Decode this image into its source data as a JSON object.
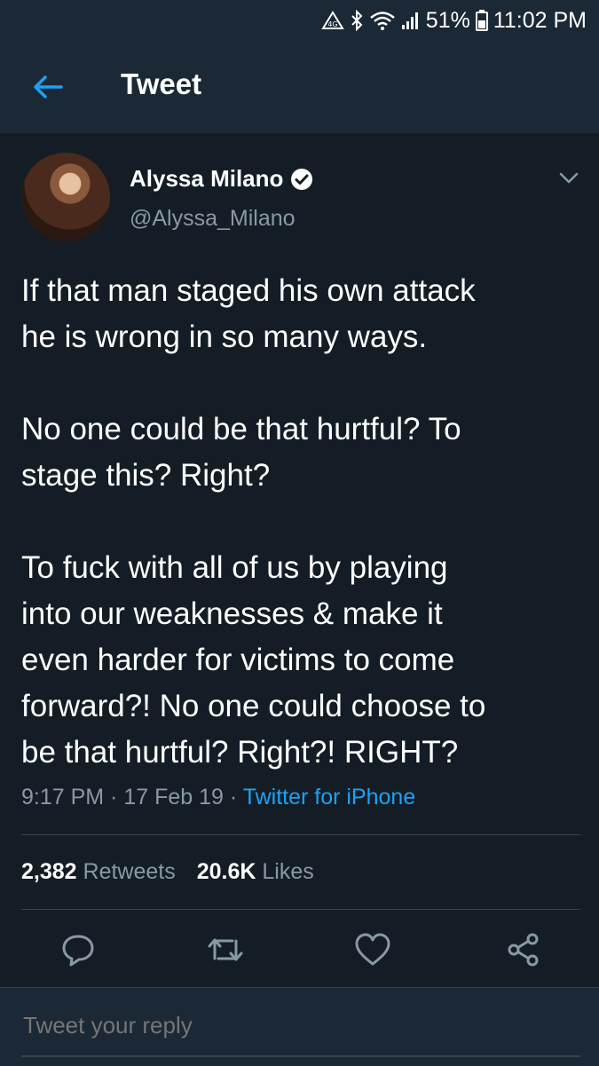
{
  "status_bar": {
    "battery": "51%",
    "time": "11:02 PM"
  },
  "app_bar": {
    "title": "Tweet"
  },
  "tweet": {
    "author_name": "Alyssa Milano",
    "author_handle": "@Alyssa_Milano",
    "text": "If that man staged his own attack\nhe is wrong in so many ways.\n\nNo one could be that hurtful? To\nstage this? Right?\n\nTo fuck with all of us by playing\ninto our weaknesses & make it\neven harder for victims to come\nforward?! No one could choose to\nbe that hurtful? Right?! RIGHT?",
    "time": "9:17 PM",
    "date": "17 Feb 19",
    "separator": " · ",
    "source": "Twitter for iPhone",
    "retweet_count": "2,382",
    "retweet_label": "Retweets",
    "like_count": "20.6K",
    "like_label": "Likes"
  },
  "reply": {
    "placeholder": "Tweet your reply"
  },
  "colors": {
    "background": "#141d26",
    "bar": "#1b2836",
    "accent": "#1da1f2",
    "muted": "#8899a6"
  }
}
